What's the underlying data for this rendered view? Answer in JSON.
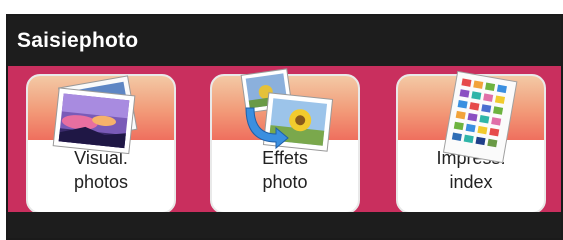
{
  "title": "Saisiephoto",
  "buttons": [
    {
      "line1": "Visual.",
      "line2": "photos",
      "icon": "photo-stack-icon"
    },
    {
      "line1": "Effets",
      "line2": "photo",
      "icon": "photo-effects-icon"
    },
    {
      "line1": "Impress.",
      "line2": "index",
      "icon": "index-sheet-icon"
    }
  ],
  "colors": {
    "title_bar": "#1d1d1d",
    "background": "#c92f5e",
    "tile": "#ffffff",
    "tile_gradient_top": "#f3c9a5",
    "tile_gradient_bottom": "#ef6f5e"
  }
}
